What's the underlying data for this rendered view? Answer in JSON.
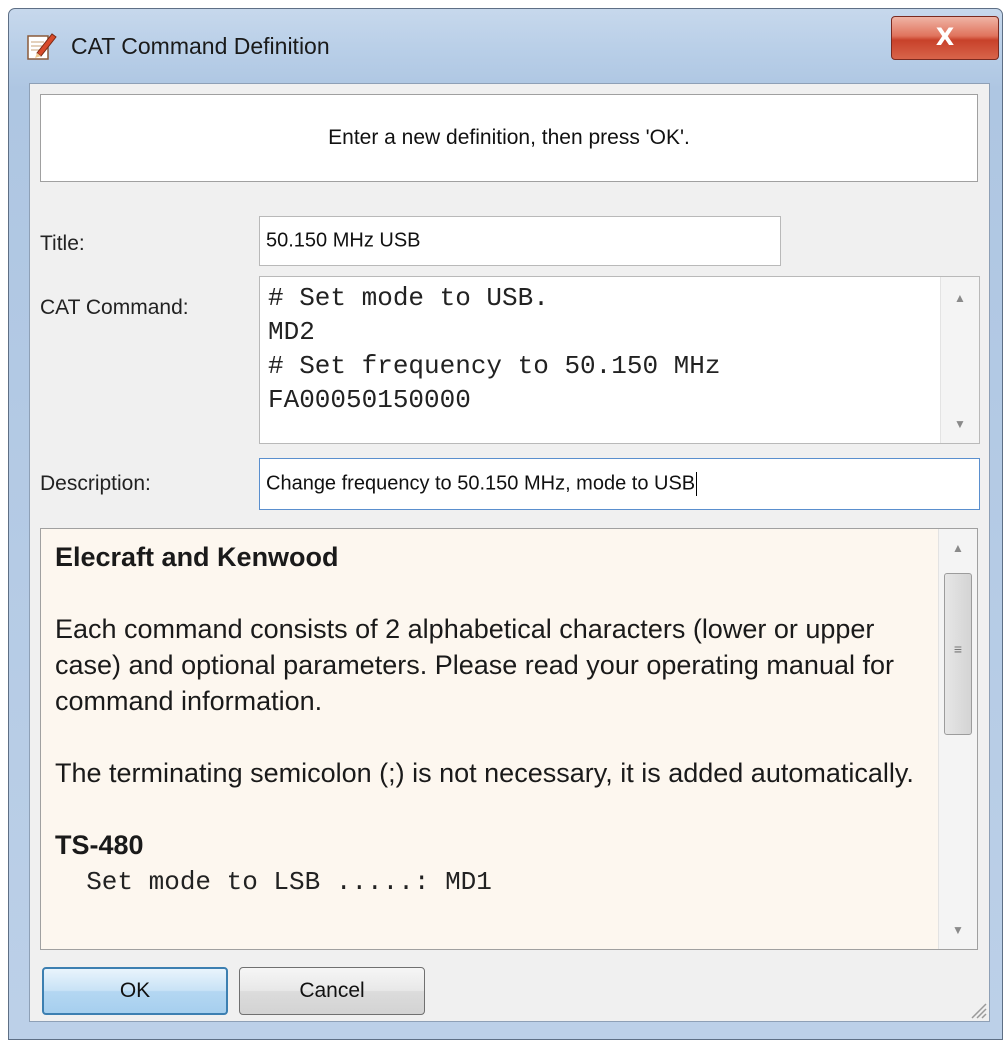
{
  "window": {
    "title": "CAT Command Definition",
    "close_label": "X"
  },
  "banner": {
    "text": "Enter a new definition, then press 'OK'."
  },
  "form": {
    "title_label": "Title:",
    "title_value": "50.150 MHz USB",
    "cat_label": "CAT Command:",
    "cat_lines": [
      "# Set mode to USB.",
      "MD2",
      "# Set frequency to 50.150 MHz",
      "FA00050150000"
    ],
    "description_label": "Description:",
    "description_value": "Change frequency to 50.150 MHz, mode to USB"
  },
  "help": {
    "heading": "Elecraft and Kenwood",
    "para1": "Each command consists of 2 alphabetical characters (lower or upper case) and optional parameters. Please read your operating manual for command information.",
    "para2": "The terminating semicolon (;) is not necessary, it is added automatically.",
    "subheading": "TS-480",
    "example": "  Set mode to LSB .....: MD1"
  },
  "buttons": {
    "ok": "OK",
    "cancel": "Cancel"
  },
  "colors": {
    "help_bg": "#fdf7ef",
    "title_bar": "#b9cfe8",
    "close_red": "#c8412a",
    "default_button": "#3c7fb1"
  },
  "icons": {
    "app": "notepad-pencil-icon",
    "close": "close-icon",
    "scroll_up": "scroll-up-arrow-icon",
    "scroll_down": "scroll-down-arrow-icon"
  }
}
